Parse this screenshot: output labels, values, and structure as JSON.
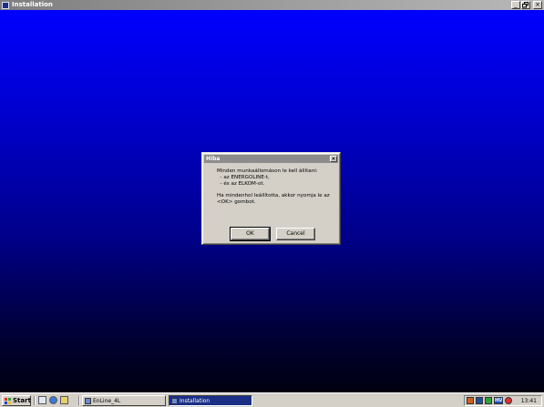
{
  "window": {
    "title": "Installation",
    "controls": [
      "_",
      "×"
    ]
  },
  "dialog": {
    "title": "Hiba",
    "close_symbol": "×",
    "message": [
      "Minden munkaállomáson le kell állítani:",
      "  - az ENERGOLINE-t,",
      "  - és az ELKOM-ot.",
      "",
      "Ha mindenhol leállította, akkor nyomja le az",
      "<OK> gombot."
    ],
    "ok_label": "OK",
    "cancel_label": "Cancel"
  },
  "taskbar": {
    "start_label": "Start",
    "quick_launch": [
      "show-desktop-icon",
      "internet-explorer-icon",
      "outlook-express-icon"
    ],
    "tasks": [
      {
        "label": "EnLine_4L",
        "active": false
      },
      {
        "label": "Installation",
        "active": true
      }
    ],
    "tray_icons": [
      "sound-icon",
      "network-icon",
      "antivirus-icon",
      "language-hu-icon",
      "security-icon"
    ],
    "tray_language": "HU",
    "clock": "13:41"
  }
}
